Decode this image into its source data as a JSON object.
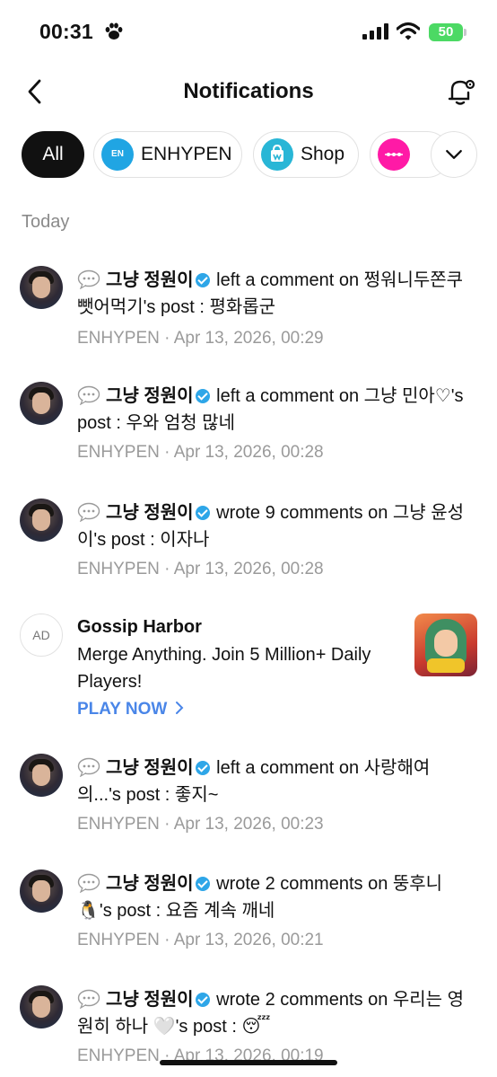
{
  "status_bar": {
    "time": "00:31",
    "battery": "50"
  },
  "header": {
    "title": "Notifications"
  },
  "filters": {
    "all": "All",
    "enhypen": "ENHYPEN",
    "enhypen_icon_text": "EN",
    "shop": "Shop"
  },
  "section": {
    "today": "Today"
  },
  "notifications": [
    {
      "author": "그냥 정원이",
      "action": "left a comment on 쩡워니두쫀쿠뺏어먹기's post : 평화롭군",
      "source": "ENHYPEN",
      "date": "Apr 13, 2026, 00:29"
    },
    {
      "author": "그냥 정원이",
      "action": "left a comment on 그냥 민아♡'s post : 우와 엄청 많네",
      "source": "ENHYPEN",
      "date": "Apr 13, 2026, 00:28"
    },
    {
      "author": "그냥 정원이",
      "action": "wrote 9 comments on 그냥 윤성이's post : 이자나",
      "source": "ENHYPEN",
      "date": "Apr 13, 2026, 00:28"
    },
    {
      "author": "그냥 정원이",
      "action": "left a comment on 사랑해여의...'s post : 좋지~",
      "source": "ENHYPEN",
      "date": "Apr 13, 2026, 00:23"
    },
    {
      "author": "그냥 정원이",
      "action": "wrote 2 comments on 뚱후니🐧's post : 요즘 계속 깨네",
      "source": "ENHYPEN",
      "date": "Apr 13, 2026, 00:21"
    },
    {
      "author": "그냥 정원이",
      "action": "wrote 2 comments on 우리는 영원히 하나 🤍's post : 😴",
      "source": "ENHYPEN",
      "date": "Apr 13, 2026, 00:19"
    }
  ],
  "ad": {
    "badge": "AD",
    "title": "Gossip Harbor",
    "text": "Merge Anything. Join 5 Million+ Daily Players!",
    "cta": "PLAY NOW"
  },
  "colors": {
    "accent": "#4a86e8",
    "verified": "#2ea6e8",
    "battery": "#4cd964"
  }
}
